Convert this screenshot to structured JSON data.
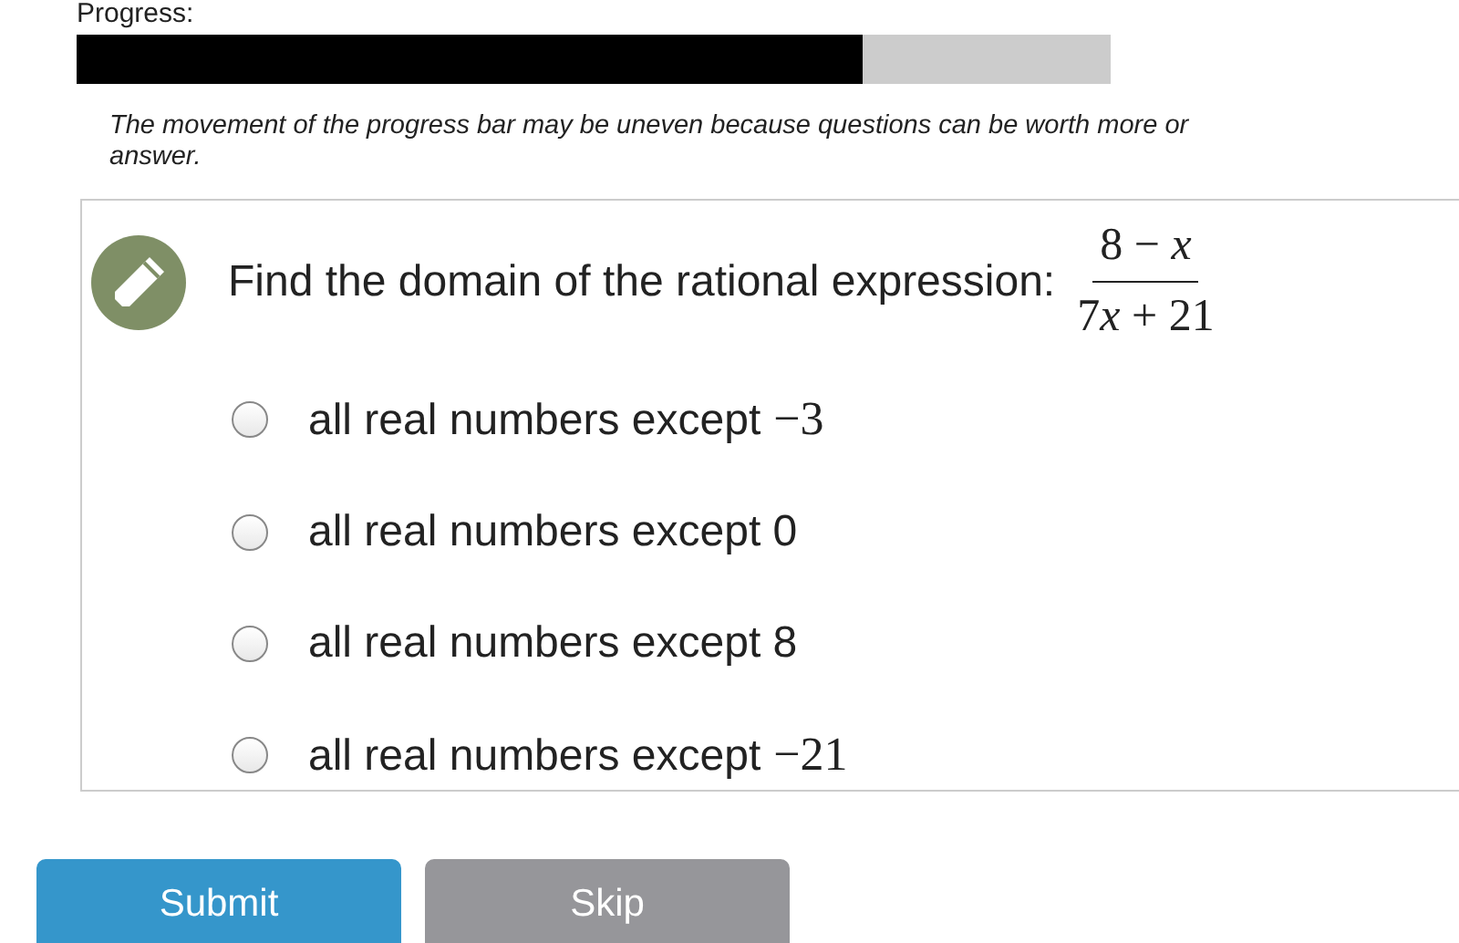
{
  "progress": {
    "label": "Progress:",
    "level": 0.76
  },
  "note": {
    "lines": [
      "The movement of the progress bar may be uneven because questions can be worth more or",
      "answer."
    ]
  },
  "question": {
    "prompt": "Find the domain of the rational expression:",
    "numerator": "8 − *x*",
    "denominator": [
      "7",
      "*x* + 21"
    ]
  },
  "options": [
    {
      "text": "all real numbers except",
      "math": "−3",
      "selected": false
    },
    {
      "text": "all real numbers except 0",
      "selected": false
    },
    {
      "text": "all real numbers except 8",
      "selected": false
    },
    {
      "text": "all real numbers except",
      "math": "−21",
      "selected": false
    }
  ],
  "buttons": [
    {
      "label": "Submit",
      "kind": "primary"
    },
    {
      "label": "Skip",
      "kind": "secondary"
    }
  ]
}
